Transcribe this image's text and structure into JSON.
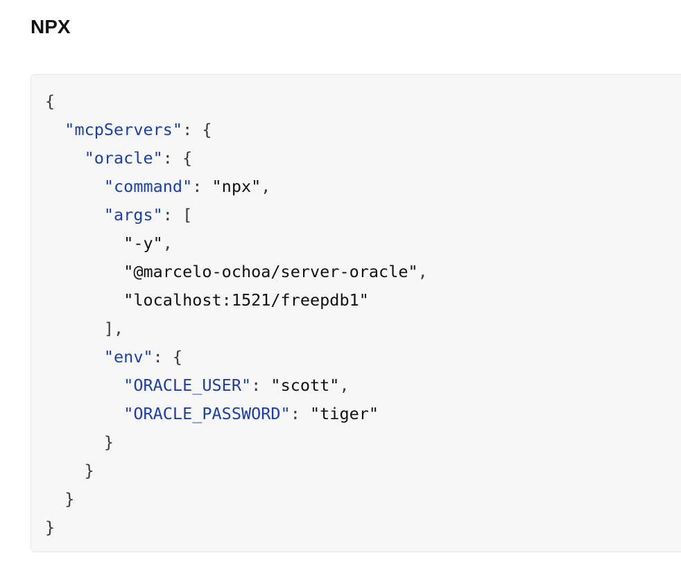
{
  "heading": "NPX",
  "code_block": {
    "language": "json",
    "colors": {
      "background": "#f7f7f7",
      "key": "#1b3fa8",
      "punctuation": "#3a3a3a",
      "string_value": "#111111"
    },
    "lines": [
      [
        {
          "t": "{",
          "k": "punct"
        }
      ],
      [
        {
          "t": "  ",
          "k": "ws"
        },
        {
          "t": "\"mcpServers\"",
          "k": "key"
        },
        {
          "t": ": {",
          "k": "punct"
        }
      ],
      [
        {
          "t": "    ",
          "k": "ws"
        },
        {
          "t": "\"oracle\"",
          "k": "key"
        },
        {
          "t": ": {",
          "k": "punct"
        }
      ],
      [
        {
          "t": "      ",
          "k": "ws"
        },
        {
          "t": "\"command\"",
          "k": "key"
        },
        {
          "t": ": ",
          "k": "punct"
        },
        {
          "t": "\"npx\"",
          "k": "string"
        },
        {
          "t": ",",
          "k": "punct"
        }
      ],
      [
        {
          "t": "      ",
          "k": "ws"
        },
        {
          "t": "\"args\"",
          "k": "key"
        },
        {
          "t": ": [",
          "k": "punct"
        }
      ],
      [
        {
          "t": "        ",
          "k": "ws"
        },
        {
          "t": "\"-y\"",
          "k": "string"
        },
        {
          "t": ",",
          "k": "punct"
        }
      ],
      [
        {
          "t": "        ",
          "k": "ws"
        },
        {
          "t": "\"@marcelo-ochoa/server-oracle\"",
          "k": "string"
        },
        {
          "t": ",",
          "k": "punct"
        }
      ],
      [
        {
          "t": "        ",
          "k": "ws"
        },
        {
          "t": "\"localhost:1521/freepdb1\"",
          "k": "string"
        }
      ],
      [
        {
          "t": "      ",
          "k": "ws"
        },
        {
          "t": "],",
          "k": "punct"
        }
      ],
      [
        {
          "t": "      ",
          "k": "ws"
        },
        {
          "t": "\"env\"",
          "k": "key"
        },
        {
          "t": ": {",
          "k": "punct"
        }
      ],
      [
        {
          "t": "        ",
          "k": "ws"
        },
        {
          "t": "\"ORACLE_USER\"",
          "k": "key"
        },
        {
          "t": ": ",
          "k": "punct"
        },
        {
          "t": "\"scott\"",
          "k": "string"
        },
        {
          "t": ",",
          "k": "punct"
        }
      ],
      [
        {
          "t": "        ",
          "k": "ws"
        },
        {
          "t": "\"ORACLE_PASSWORD\"",
          "k": "key"
        },
        {
          "t": ": ",
          "k": "punct"
        },
        {
          "t": "\"tiger\"",
          "k": "string"
        }
      ],
      [
        {
          "t": "      ",
          "k": "ws"
        },
        {
          "t": "}",
          "k": "punct"
        }
      ],
      [
        {
          "t": "    ",
          "k": "ws"
        },
        {
          "t": "}",
          "k": "punct"
        }
      ],
      [
        {
          "t": "  ",
          "k": "ws"
        },
        {
          "t": "}",
          "k": "punct"
        }
      ],
      [
        {
          "t": "}",
          "k": "punct"
        }
      ]
    ]
  }
}
